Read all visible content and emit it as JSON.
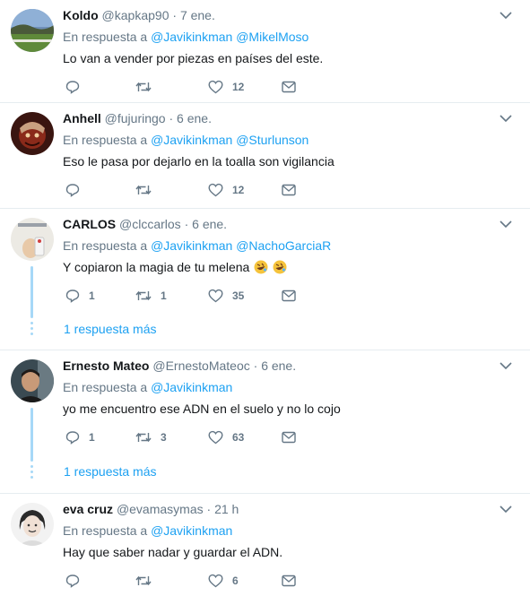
{
  "tweets": [
    {
      "name": "Koldo",
      "handle": "@kapkap90",
      "time": "7 ene.",
      "reply_prefix": "En respuesta a",
      "mentions": [
        "@Javikinkman",
        "@MikelMoso"
      ],
      "text": "Lo van a vender por piezas en países del este.",
      "replies": "",
      "retweets": "",
      "likes": "12"
    },
    {
      "name": "Anhell",
      "handle": "@fujuringo",
      "time": "6 ene.",
      "reply_prefix": "En respuesta a",
      "mentions": [
        "@Javikinkman",
        "@Sturlunson"
      ],
      "text": "Eso le pasa por dejarlo en la toalla son vigilancia",
      "replies": "",
      "retweets": "",
      "likes": "12"
    },
    {
      "name": "CARLOS",
      "handle": "@clccarlos",
      "time": "6 ene.",
      "reply_prefix": "En respuesta a",
      "mentions": [
        "@Javikinkman",
        "@NachoGarciaR"
      ],
      "text": "Y copiaron la magia de tu melena",
      "replies": "1",
      "retweets": "1",
      "likes": "35",
      "more": "1 respuesta más"
    },
    {
      "name": "Ernesto Mateo",
      "handle": "@ErnestoMateoc",
      "time": "6 ene.",
      "reply_prefix": "En respuesta a",
      "mentions": [
        "@Javikinkman"
      ],
      "text": "yo me encuentro ese ADN en el suelo y no lo cojo",
      "replies": "1",
      "retweets": "3",
      "likes": "63",
      "more": "1 respuesta más"
    },
    {
      "name": "eva cruz",
      "handle": "@evamasymas",
      "time": "21 h",
      "reply_prefix": "En respuesta a",
      "mentions": [
        "@Javikinkman"
      ],
      "text": "Hay que saber nadar y guardar el ADN.",
      "replies": "",
      "retweets": "",
      "likes": "6"
    }
  ],
  "separator": "·",
  "colors": {
    "link": "#1da1f2",
    "muted": "#657786",
    "thread": "#a6d8f7"
  },
  "icons": [
    "reply-icon",
    "retweet-icon",
    "like-icon",
    "direct-message-icon",
    "chevron-down-icon",
    "rofl-emoji"
  ]
}
